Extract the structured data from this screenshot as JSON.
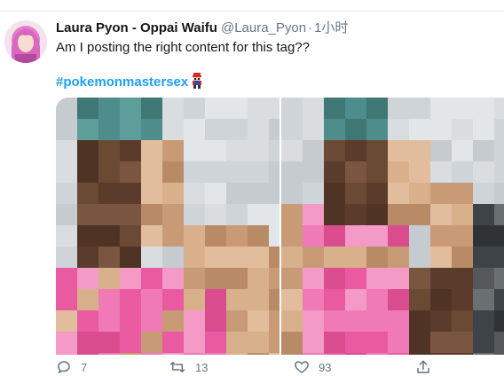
{
  "tweet": {
    "author": {
      "display_name": "Laura Pyon - Oppai Waifu",
      "handle": "@Laura_Pyon",
      "separator": "·",
      "time": "1小时"
    },
    "text": "Am I posting the right content for this tag??",
    "hashtag": "#pokemonmastersex",
    "emoji_icon": "trainer-emoji-icon",
    "media": {
      "count": 2,
      "pixelated": true
    },
    "actions": {
      "reply_count": "7",
      "retweet_count": "13",
      "like_count": "93"
    }
  },
  "colors": {
    "text": "#14171a",
    "secondary": "#657786",
    "hashtag": "#1da1f2",
    "divider": "#e6ecf0"
  },
  "icons": [
    "reply-icon",
    "retweet-icon",
    "like-icon",
    "share-icon"
  ]
}
